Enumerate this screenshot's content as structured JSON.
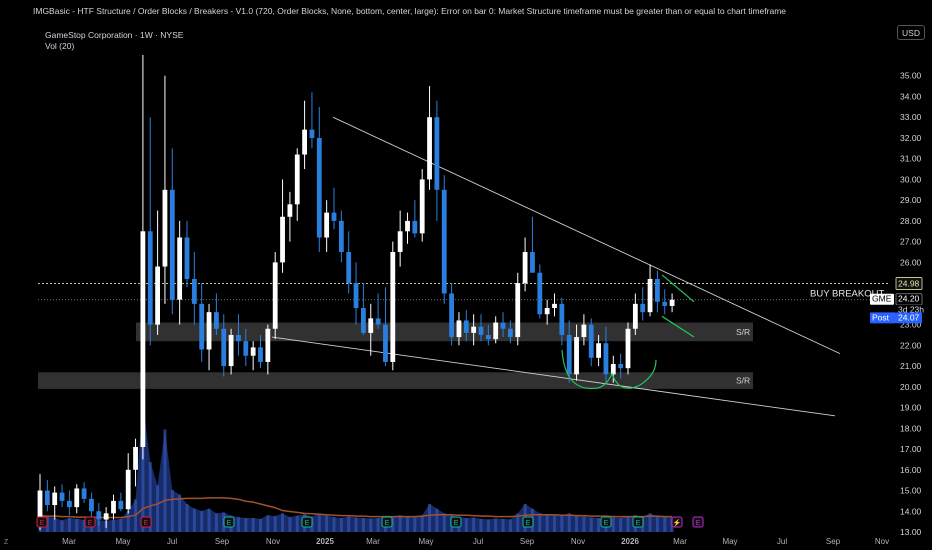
{
  "header": {
    "indicator_text": "IMGBasic - HTF Structure / Order Blocks / Breakers - V1.0 (720, Order Blocks, None, bottom, center, large): Error on bar 0: Market Structure timeframe must be greater than or equal to chart timeframe",
    "symbol_line": "GameStop Corporation · 1W · NYSE",
    "volume_label": "Vol (20)",
    "currency_button": "USD",
    "corner_label": "Z"
  },
  "colors": {
    "background": "#000000",
    "candle": "#ffffff",
    "candle_down": "#2a7fde",
    "volume_fill": "#1e3a8a",
    "volume_ma": "#a0522d",
    "trendline": "#cfcfcf",
    "sr_zone": "#3a3a3a",
    "pattern_green": "#22c55e",
    "breakout_line": "#e8e2a0",
    "post_label": "#2962ff"
  },
  "chart_data": {
    "type": "candlestick",
    "symbol": "GME",
    "timeframe": "1W",
    "ylim": [
      13.0,
      36.0
    ],
    "y_ticks": [
      "35.00",
      "34.00",
      "33.00",
      "32.00",
      "31.00",
      "30.00",
      "29.00",
      "28.00",
      "27.00",
      "26.00",
      "25.00",
      "24.00",
      "23.00",
      "22.00",
      "21.00",
      "20.00",
      "19.00",
      "18.00",
      "17.00",
      "16.00",
      "15.00",
      "14.00",
      "13.00"
    ],
    "x_ticks": [
      "Mar",
      "May",
      "Jul",
      "Sep",
      "Nov",
      "2025",
      "Mar",
      "May",
      "Jul",
      "Sep",
      "Nov",
      "2026",
      "Mar",
      "May",
      "Jul",
      "Sep",
      "Nov"
    ],
    "candles": [
      [
        13.5,
        15.8,
        13.1,
        15.0
      ],
      [
        15.0,
        15.5,
        14.0,
        14.3
      ],
      [
        14.3,
        15.2,
        13.6,
        14.9
      ],
      [
        14.9,
        15.3,
        14.2,
        14.5
      ],
      [
        14.5,
        15.0,
        13.8,
        14.2
      ],
      [
        14.2,
        15.3,
        13.9,
        15.1
      ],
      [
        15.1,
        15.4,
        14.4,
        14.6
      ],
      [
        14.6,
        14.9,
        13.7,
        14.0
      ],
      [
        14.0,
        14.4,
        13.3,
        13.6
      ],
      [
        13.6,
        14.2,
        13.2,
        13.9
      ],
      [
        13.9,
        14.8,
        13.6,
        14.5
      ],
      [
        14.5,
        14.9,
        14.0,
        14.1
      ],
      [
        14.1,
        16.8,
        13.9,
        16.0
      ],
      [
        16.0,
        17.5,
        15.2,
        17.1
      ],
      [
        17.1,
        36.0,
        16.5,
        27.5
      ],
      [
        27.5,
        33.0,
        22.0,
        23.0
      ],
      [
        23.0,
        28.5,
        22.5,
        25.8
      ],
      [
        25.8,
        35.0,
        24.0,
        29.5
      ],
      [
        29.5,
        31.5,
        23.5,
        24.2
      ],
      [
        24.2,
        28.0,
        23.0,
        27.2
      ],
      [
        27.2,
        28.0,
        24.8,
        25.2
      ],
      [
        25.2,
        26.5,
        23.0,
        24.0
      ],
      [
        24.0,
        25.0,
        21.2,
        21.8
      ],
      [
        21.8,
        24.0,
        20.8,
        23.6
      ],
      [
        23.6,
        24.5,
        22.5,
        22.8
      ],
      [
        22.8,
        23.5,
        20.5,
        21.0
      ],
      [
        21.0,
        22.8,
        20.6,
        22.5
      ],
      [
        22.5,
        23.5,
        21.5,
        22.2
      ],
      [
        22.2,
        22.8,
        21.0,
        21.5
      ],
      [
        21.5,
        22.2,
        20.8,
        21.9
      ],
      [
        21.9,
        22.5,
        20.9,
        21.2
      ],
      [
        21.2,
        23.0,
        20.6,
        22.8
      ],
      [
        22.8,
        26.5,
        22.3,
        26.0
      ],
      [
        26.0,
        30.0,
        25.5,
        28.2
      ],
      [
        28.2,
        29.4,
        27.0,
        28.8
      ],
      [
        28.8,
        31.5,
        28.0,
        31.2
      ],
      [
        31.2,
        33.8,
        30.5,
        32.4
      ],
      [
        32.4,
        34.2,
        31.5,
        32.0
      ],
      [
        32.0,
        33.5,
        26.5,
        27.2
      ],
      [
        27.2,
        29.0,
        26.5,
        28.4
      ],
      [
        28.4,
        29.6,
        27.6,
        28.0
      ],
      [
        28.0,
        28.5,
        26.0,
        26.5
      ],
      [
        26.5,
        27.5,
        24.5,
        25.0
      ],
      [
        25.0,
        26.0,
        23.0,
        23.8
      ],
      [
        23.8,
        25.0,
        22.5,
        22.6
      ],
      [
        22.6,
        24.0,
        21.5,
        23.3
      ],
      [
        23.3,
        24.5,
        22.8,
        23.0
      ],
      [
        23.0,
        24.8,
        21.0,
        21.2
      ],
      [
        21.2,
        27.0,
        20.8,
        26.5
      ],
      [
        26.5,
        28.5,
        25.8,
        27.5
      ],
      [
        27.5,
        28.4,
        26.9,
        28.0
      ],
      [
        28.0,
        29.0,
        27.2,
        27.4
      ],
      [
        27.4,
        30.5,
        27.0,
        30.0
      ],
      [
        30.0,
        34.5,
        29.5,
        33.0
      ],
      [
        33.0,
        33.8,
        28.0,
        29.5
      ],
      [
        29.5,
        30.2,
        24.0,
        24.5
      ],
      [
        24.5,
        25.0,
        22.0,
        22.4
      ],
      [
        22.4,
        23.6,
        22.0,
        23.2
      ],
      [
        23.2,
        23.7,
        22.2,
        22.6
      ],
      [
        22.6,
        23.5,
        22.0,
        22.9
      ],
      [
        22.9,
        23.5,
        22.2,
        22.5
      ],
      [
        22.5,
        23.0,
        22.0,
        22.3
      ],
      [
        22.3,
        23.4,
        22.1,
        23.1
      ],
      [
        23.1,
        23.6,
        22.4,
        22.8
      ],
      [
        22.8,
        23.2,
        22.1,
        22.4
      ],
      [
        22.4,
        25.5,
        22.0,
        25.0
      ],
      [
        25.0,
        27.2,
        24.6,
        26.5
      ],
      [
        26.5,
        28.2,
        25.9,
        25.5
      ],
      [
        25.5,
        25.9,
        23.3,
        23.5
      ],
      [
        23.5,
        24.2,
        23.0,
        23.8
      ],
      [
        23.8,
        24.5,
        23.4,
        24.0
      ],
      [
        24.0,
        24.3,
        22.0,
        22.5
      ],
      [
        22.5,
        23.2,
        20.2,
        20.6
      ],
      [
        20.6,
        23.0,
        20.3,
        22.4
      ],
      [
        22.4,
        23.5,
        22.0,
        23.0
      ],
      [
        23.0,
        23.3,
        21.0,
        21.4
      ],
      [
        21.4,
        22.5,
        21.0,
        22.1
      ],
      [
        22.1,
        22.9,
        20.2,
        20.6
      ],
      [
        20.6,
        21.5,
        20.2,
        21.1
      ],
      [
        21.1,
        21.6,
        20.4,
        20.9
      ],
      [
        20.9,
        23.1,
        20.6,
        22.8
      ],
      [
        22.8,
        24.5,
        22.5,
        24.0
      ],
      [
        24.0,
        24.8,
        23.2,
        23.6
      ],
      [
        23.6,
        25.9,
        23.4,
        25.2
      ],
      [
        25.2,
        25.6,
        23.6,
        24.1
      ],
      [
        24.1,
        24.7,
        23.5,
        23.9
      ],
      [
        23.9,
        24.5,
        23.6,
        24.2
      ]
    ],
    "volume_ylim": [
      0,
      30
    ],
    "volume": [
      3,
      3.5,
      3,
      2.5,
      3,
      2.8,
      2.6,
      3.2,
      2.5,
      2.4,
      2.6,
      2.8,
      4.5,
      7,
      28,
      15,
      10,
      22,
      9,
      8,
      6,
      5,
      4.5,
      5,
      4,
      4.2,
      3.5,
      3.2,
      3,
      3,
      2.8,
      3.6,
      3.4,
      4,
      3.2,
      3.5,
      3.8,
      3.3,
      4,
      3.5,
      3.2,
      3,
      3.3,
      3.1,
      3,
      2.9,
      3,
      3.2,
      3.4,
      3.6,
      3.3,
      3.1,
      3.6,
      6,
      5,
      4,
      3.5,
      3.2,
      3,
      3.1,
      2.8,
      2.7,
      2.9,
      2.8,
      2.7,
      4,
      6,
      5,
      4,
      3.8,
      3.5,
      3.6,
      4,
      3.5,
      3.3,
      3.1,
      3,
      3.2,
      3.1,
      3,
      3.4,
      3.6,
      3.3,
      4,
      3.4,
      3.2,
      3.1
    ],
    "volume_ma": [
      3.5,
      3.4,
      3.4,
      3.3,
      3.3,
      3.2,
      3.2,
      3.2,
      3.1,
      3.1,
      3.1,
      3.1,
      3.3,
      3.6,
      5.0,
      5.6,
      6.0,
      6.8,
      7.0,
      7.1,
      7.2,
      7.2,
      7.2,
      7.3,
      7.3,
      7.3,
      7.2,
      7.0,
      6.6,
      6.4,
      6.0,
      5.6,
      5.2,
      4.6,
      4.4,
      4.2,
      4.0,
      3.9,
      3.8,
      3.7,
      3.6,
      3.5,
      3.5,
      3.4,
      3.4,
      3.3,
      3.3,
      3.3,
      3.3,
      3.3,
      3.3,
      3.3,
      3.4,
      3.6,
      3.7,
      3.7,
      3.7,
      3.6,
      3.6,
      3.5,
      3.4,
      3.4,
      3.3,
      3.3,
      3.3,
      3.4,
      3.6,
      3.7,
      3.7,
      3.7,
      3.7,
      3.6,
      3.6,
      3.5,
      3.5,
      3.4,
      3.4,
      3.4,
      3.3,
      3.3,
      3.3,
      3.3,
      3.3,
      3.4,
      3.4,
      3.3,
      3.3
    ],
    "sr_zones": [
      {
        "label": "S/R",
        "y_top": 23.1,
        "y_bottom": 22.2
      },
      {
        "label": "S/R",
        "y_top": 20.7,
        "y_bottom": 19.9
      }
    ],
    "breakout": {
      "label": "BUY BREAKOUT",
      "price": 24.98
    },
    "price_labels": {
      "breakout_value": "24.98",
      "ticker": "GME",
      "last_price": "24.20",
      "countdown": "3d 23h",
      "post_tag": "Post",
      "post_price": "24.07"
    },
    "event_markers": [
      "E",
      "E",
      "E",
      "E",
      "E",
      "E",
      "E",
      "E",
      "E",
      "E",
      "⚡",
      "E"
    ]
  }
}
